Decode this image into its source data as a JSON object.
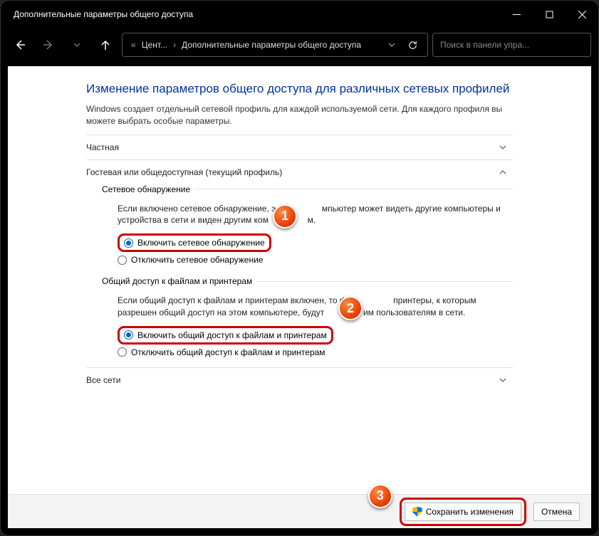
{
  "window": {
    "title": "Дополнительные параметры общего доступа"
  },
  "breadcrumb": {
    "prefix": "«",
    "part1": "Цент...",
    "sep": "›",
    "part2": "Дополнительные параметры общего доступа"
  },
  "search": {
    "placeholder": "Поиск в панели упра..."
  },
  "heading": "Изменение параметров общего доступа для различных сетевых профилей",
  "desc": "Windows создает отдельный сетевой профиль для каждой используемой сети. Для каждого профиля вы можете выбрать особые параметры.",
  "sections": {
    "private": {
      "title": "Частная",
      "expanded": false
    },
    "guest": {
      "title": "Гостевая или общедоступная (текущий профиль)",
      "expanded": true,
      "group1": {
        "label": "Сетевое обнаружение",
        "text_a": "Если включено сетевое обнаружение, э",
        "text_b": "мпьютер может видеть другие компьютеры и устройства в сети и виден другим ком",
        "text_c": "м.",
        "opt_on": "Включить сетевое обнаружение",
        "opt_off": "Отключить сетевое обнаружение"
      },
      "group2": {
        "label": "Общий доступ к файлам и принтерам",
        "text_a": "Если общий доступ к файлам и принтерам включен, то фа",
        "text_b": "принтеры, к которым разрешен общий доступ на этом компьютере, будут ",
        "text_c": "им пользователям в сети.",
        "opt_on": "Включить общий доступ к файлам и принтерам",
        "opt_off": "Отключить общий доступ к файлам и принтерам"
      }
    },
    "all": {
      "title": "Все сети",
      "expanded": false
    }
  },
  "footer": {
    "save": "Сохранить изменения",
    "cancel": "Отмена"
  },
  "badges": {
    "b1": "1",
    "b2": "2",
    "b3": "3"
  }
}
